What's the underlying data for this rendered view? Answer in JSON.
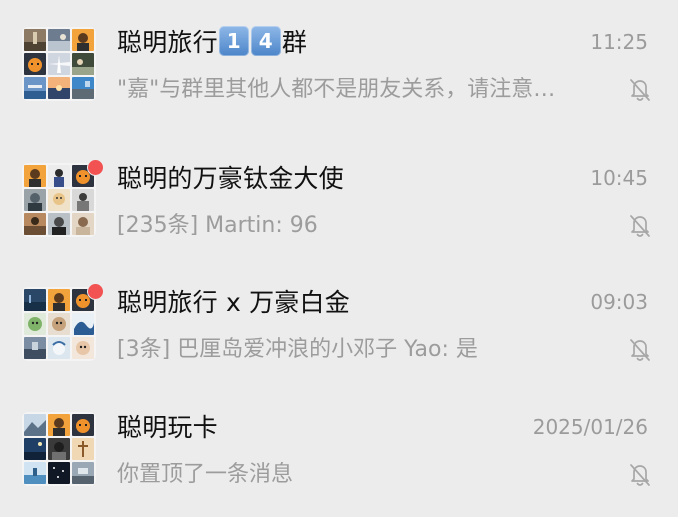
{
  "colors": {
    "background": "#ececec",
    "title_text": "#111111",
    "secondary_text": "#9c9c9c",
    "unread_dot": "#f25252",
    "badge": "#4c85c9"
  },
  "chats": [
    {
      "title_prefix": "聪明旅行",
      "badges": [
        "1",
        "4"
      ],
      "title_suffix": "群",
      "time": "11:25",
      "preview": "\"嘉\"与群里其他人都不是朋友关系，请注意…",
      "unread": false,
      "muted": true,
      "mute_icon": "bell-slash-icon",
      "avatar_icon": "group-avatar-grid"
    },
    {
      "title": "聪明的万豪钛金大使",
      "time": "10:45",
      "preview": "[235条] Martin: 96",
      "unread": true,
      "muted": true,
      "mute_icon": "bell-slash-icon",
      "avatar_icon": "group-avatar-grid"
    },
    {
      "title": "聪明旅行 x 万豪白金",
      "time": "09:03",
      "preview": "[3条] 巴厘岛爱冲浪的小邓子 Yao: 是",
      "unread": true,
      "muted": true,
      "mute_icon": "bell-slash-icon",
      "avatar_icon": "group-avatar-grid"
    },
    {
      "title": "聪明玩卡",
      "time": "2025/01/26",
      "preview": "你置顶了一条消息",
      "unread": false,
      "muted": true,
      "mute_icon": "bell-slash-icon",
      "avatar_icon": "group-avatar-grid"
    }
  ]
}
